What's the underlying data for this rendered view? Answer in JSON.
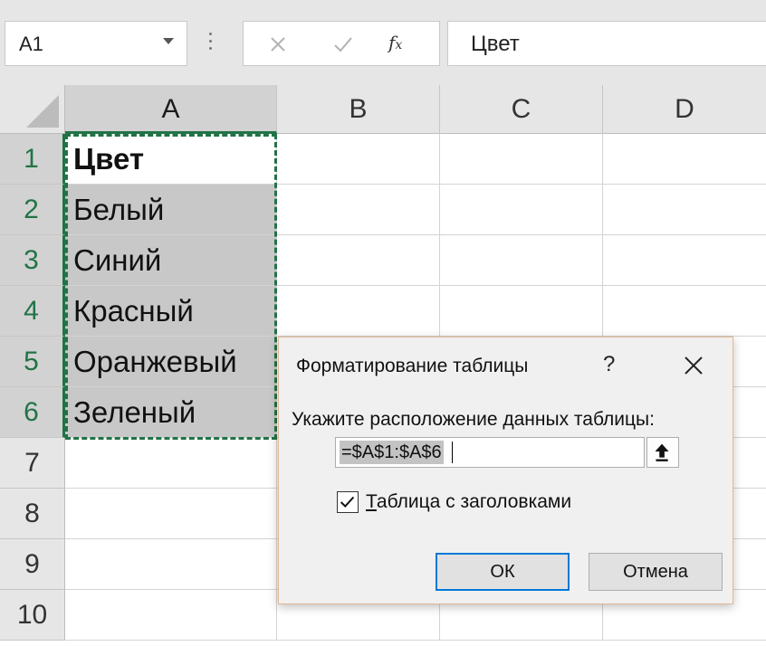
{
  "formula_bar": {
    "name_box": "A1",
    "formula": "Цвет",
    "icons": [
      "cancel-icon",
      "enter-check-icon",
      "insert-function-icon"
    ],
    "fx_label": "f",
    "fx_sub": "x"
  },
  "grid": {
    "columns": [
      "A",
      "B",
      "C",
      "D"
    ],
    "selected_column": "A",
    "rows": [
      "1",
      "2",
      "3",
      "4",
      "5",
      "6",
      "7",
      "8",
      "9",
      "10"
    ],
    "cells": {
      "A1": "Цвет",
      "A2": "Белый",
      "A3": "Синий",
      "A4": "Красный",
      "A5": "Оранжевый",
      "A6": "Зеленый"
    }
  },
  "dialog": {
    "title": "Форматирование таблицы",
    "help": "?",
    "prompt": "Укажите расположение данных таблицы:",
    "range_value": "=$A$1:$A$6",
    "checkbox_checked": true,
    "checkbox_label_first": "Т",
    "checkbox_label_rest": "аблица с заголовками",
    "ok_label": "ОК",
    "cancel_label": "Отмена"
  },
  "colors": {
    "accent_green": "#217346",
    "dialog_border": "#e0b896",
    "ok_focus": "#0078d7"
  }
}
